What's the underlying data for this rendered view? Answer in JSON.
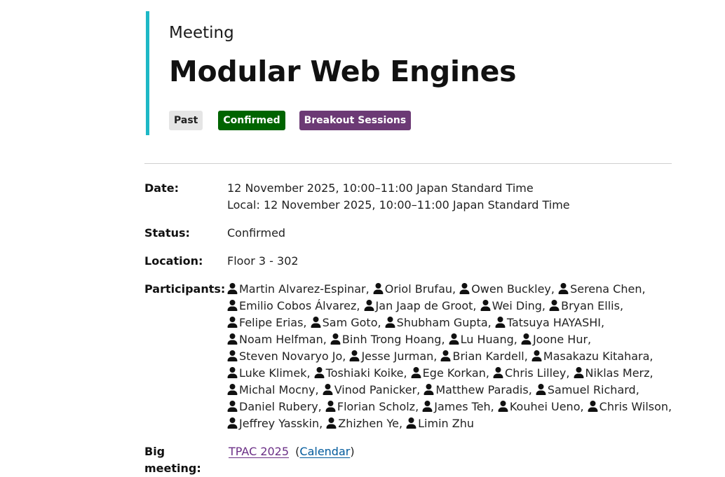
{
  "header": {
    "kicker": "Meeting",
    "title": "Modular Web Engines",
    "tags": [
      "Past",
      "Confirmed",
      "Breakout Sessions"
    ]
  },
  "details": {
    "date_label": "Date:",
    "date_line1": "12 November 2025, 10:00–11:00 Japan Standard Time",
    "date_line2": "Local: 12 November 2025, 10:00–11:00 Japan Standard Time",
    "status_label": "Status:",
    "status_value": "Confirmed",
    "location_label": "Location:",
    "location_value": "Floor 3 - 302",
    "participants_label": "Participants:",
    "participants": [
      [
        "Martin Alvarez-Espinar,",
        "Oriol Brufau,",
        "Owen Buckley,",
        "Serena Chen,"
      ],
      [
        "Emilio Cobos Álvarez,",
        "Jan Jaap de Groot,",
        "Wei Ding,",
        "Bryan Ellis,"
      ],
      [
        "Felipe Erias,",
        "Sam Goto,",
        "Shubham Gupta,",
        "Tatsuya HAYASHI,"
      ],
      [
        "Noam Helfman,",
        "Binh Trong Hoang,",
        "Lu Huang,",
        "Joone Hur,"
      ],
      [
        "Steven Novaryo Jo,",
        "Jesse Jurman,",
        "Brian Kardell,",
        "Masakazu Kitahara,"
      ],
      [
        "Luke Klimek,",
        "Toshiaki Koike,",
        "Ege Korkan,",
        "Chris Lilley,",
        "Niklas Merz,"
      ],
      [
        "Michal Mocny,",
        "Vinod Panicker,",
        "Matthew Paradis,",
        "Samuel Richard,"
      ],
      [
        "Daniel Rubery,",
        "Florian Scholz,",
        "James Teh,",
        "Kouhei Ueno,",
        "Chris Wilson,"
      ],
      [
        "Jeffrey Yasskin,",
        "Zhizhen Ye,",
        "Limin Zhu"
      ]
    ],
    "big_meeting_label": "Big meeting:",
    "big_meeting_link": "TPAC 2025",
    "paren_open": "(",
    "calendar_link": "Calendar",
    "paren_close": ")"
  },
  "icons": {
    "participant": "person-icon"
  },
  "colors": {
    "accent_bar": "#1eb8c6",
    "confirmed": "#006400",
    "breakout": "#6c3a75",
    "link": "#6b2f86",
    "link2": "#005a9c"
  }
}
